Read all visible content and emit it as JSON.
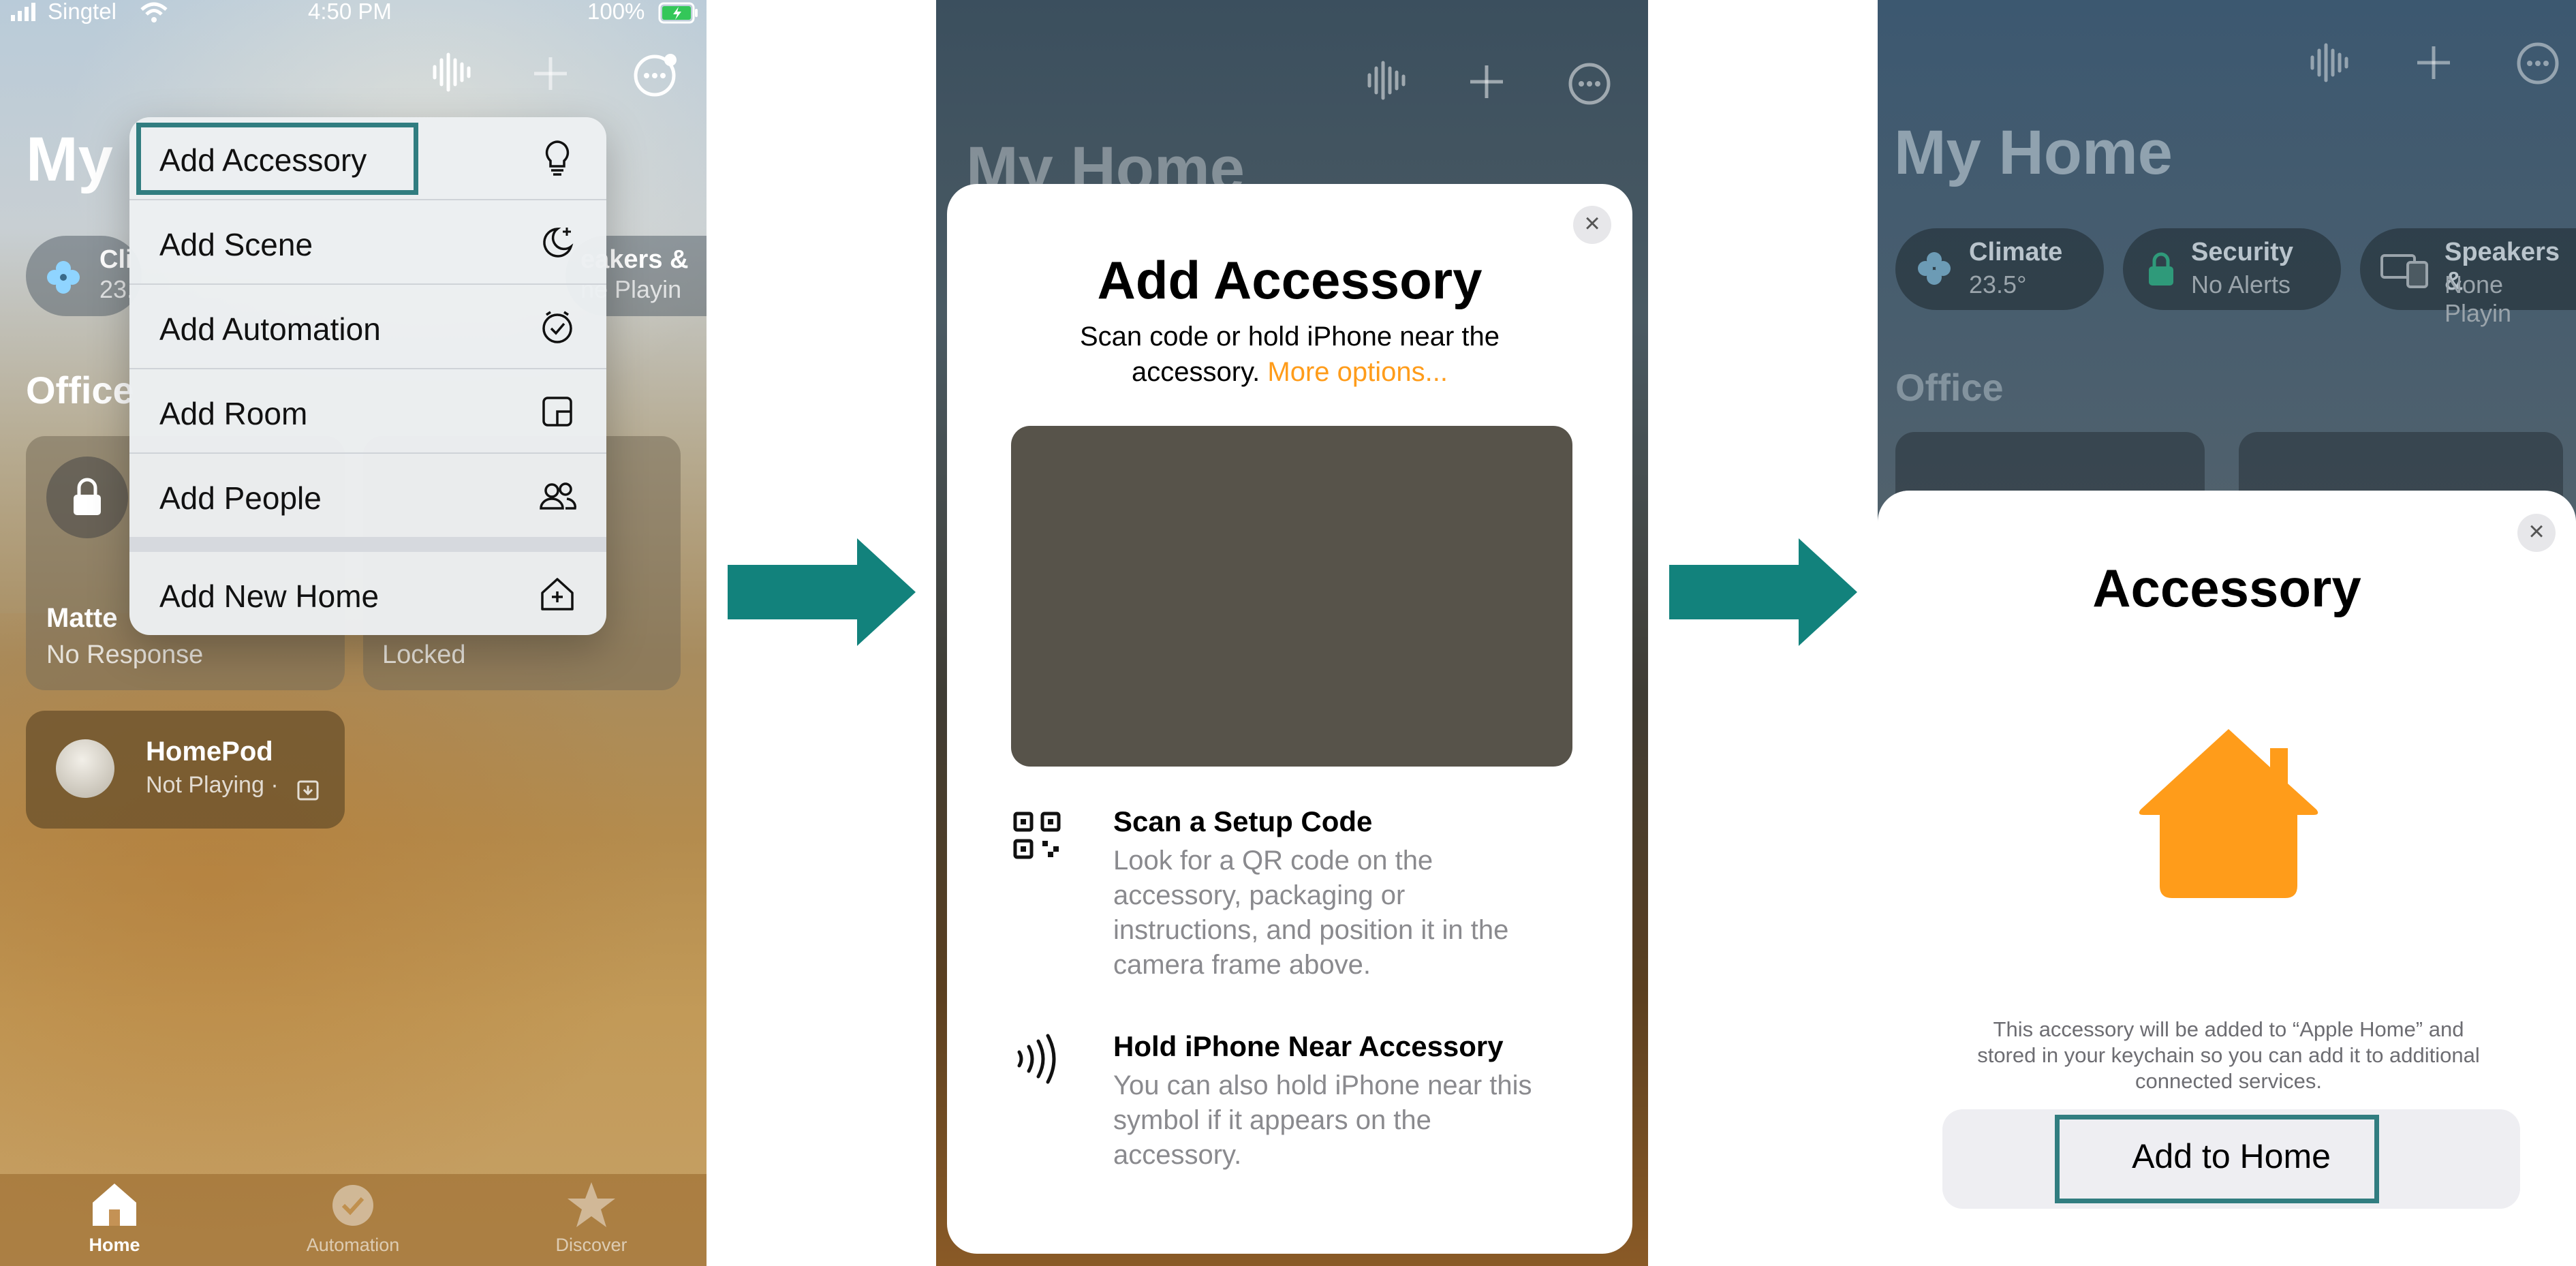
{
  "panel1": {
    "status": {
      "carrier": "Singtel",
      "time": "4:50 PM",
      "battery": "100%"
    },
    "home_title": "My",
    "chips": [
      {
        "name": "Cli",
        "value": "23."
      },
      {
        "name": "eakers &",
        "value": "ne Playin"
      }
    ],
    "section_title": "Office",
    "tiles": [
      {
        "title": "Matte",
        "subtitle": "No Response"
      },
      {
        "title": "",
        "subtitle": "Locked"
      },
      {
        "title": "HomePod",
        "subtitle": "Not Playing ·"
      }
    ],
    "menu": {
      "items": [
        {
          "label": "Add Accessory",
          "icon": "lightbulb-icon"
        },
        {
          "label": "Add Scene",
          "icon": "moon-sparkle-icon"
        },
        {
          "label": "Add Automation",
          "icon": "clock-check-icon"
        },
        {
          "label": "Add Room",
          "icon": "room-icon"
        },
        {
          "label": "Add People",
          "icon": "people-icon"
        }
      ],
      "new_home": {
        "label": "Add New Home",
        "icon": "house-plus-icon"
      }
    },
    "tabs": [
      {
        "label": "Home"
      },
      {
        "label": "Automation"
      },
      {
        "label": "Discover"
      }
    ]
  },
  "panel2": {
    "bg_title": "My Home",
    "title": "Add Accessory",
    "subtitle_line1": "Scan code or hold iPhone near the",
    "subtitle_line2": "accessory.",
    "more_options": "More options...",
    "rows": [
      {
        "icon": "qr-code-icon",
        "title": "Scan a Setup Code",
        "lines": [
          "Look for a QR code on the",
          "accessory, packaging or",
          "instructions, and position it in the",
          "camera frame above."
        ]
      },
      {
        "icon": "nfc-icon",
        "title": "Hold iPhone Near Accessory",
        "lines": [
          "You can also hold iPhone near this",
          "symbol if it appears on the",
          "accessory."
        ]
      }
    ]
  },
  "panel3": {
    "bg_title": "My Home",
    "chips": [
      {
        "name": "Climate",
        "value": "23.5°"
      },
      {
        "name": "Security",
        "value": "No Alerts"
      },
      {
        "name": "Speakers &",
        "value": "None Playin"
      }
    ],
    "section_title": "Office",
    "title": "Accessory",
    "note_lines": [
      "This accessory will be added to “Apple Home” and",
      "stored in your keychain so you can add it to additional",
      "connected services."
    ],
    "button": "Add to Home"
  },
  "colors": {
    "accent_orange": "#ff9c1a",
    "arrow_teal": "#12827c",
    "highlight_teal": "#317d80"
  }
}
